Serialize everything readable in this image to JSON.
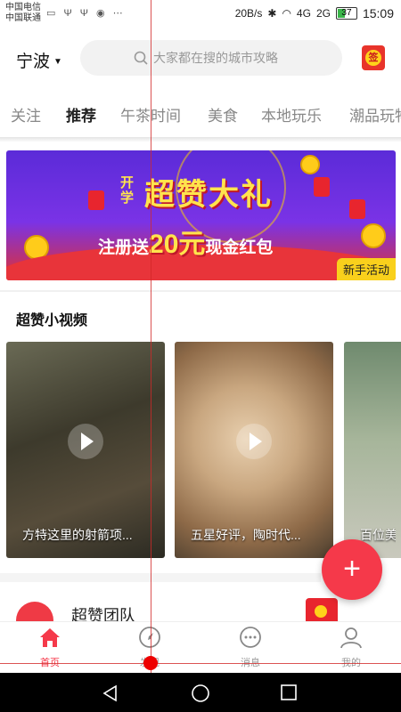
{
  "status_bar": {
    "carrier1": "中国电信",
    "carrier2": "中国联通",
    "network_speed": "20B/s",
    "signal1": "4G",
    "signal2": "2G",
    "battery": "37",
    "time": "15:09"
  },
  "header": {
    "city": "宁波",
    "search_placeholder": "大家都在搜的城市攻略",
    "checkin_label": "签"
  },
  "tabs": [
    "关注",
    "推荐",
    "午茶时间",
    "美食",
    "本地玩乐",
    "潮品玩物"
  ],
  "active_tab": "推荐",
  "banner": {
    "tag": "开学",
    "title": "超赞大礼",
    "sub_prefix": "注册送",
    "amount": "20元",
    "sub_suffix": "现金红包",
    "badge": "新手活动"
  },
  "section": {
    "title": "超赞小视频"
  },
  "videos": [
    {
      "caption": "方特这里的射箭项..."
    },
    {
      "caption": "五星好评，陶时代..."
    },
    {
      "caption": "百位美"
    }
  ],
  "team": {
    "name": "超赞团队"
  },
  "bottom_nav": [
    {
      "label": "首页",
      "icon": "home-icon",
      "active": true
    },
    {
      "label": "发现",
      "icon": "compass-icon",
      "active": false
    },
    {
      "label": "消息",
      "icon": "message-icon",
      "active": false
    },
    {
      "label": "我的",
      "icon": "user-icon",
      "active": false
    }
  ],
  "colors": {
    "accent": "#f5394a",
    "badge": "#f9d01c"
  }
}
